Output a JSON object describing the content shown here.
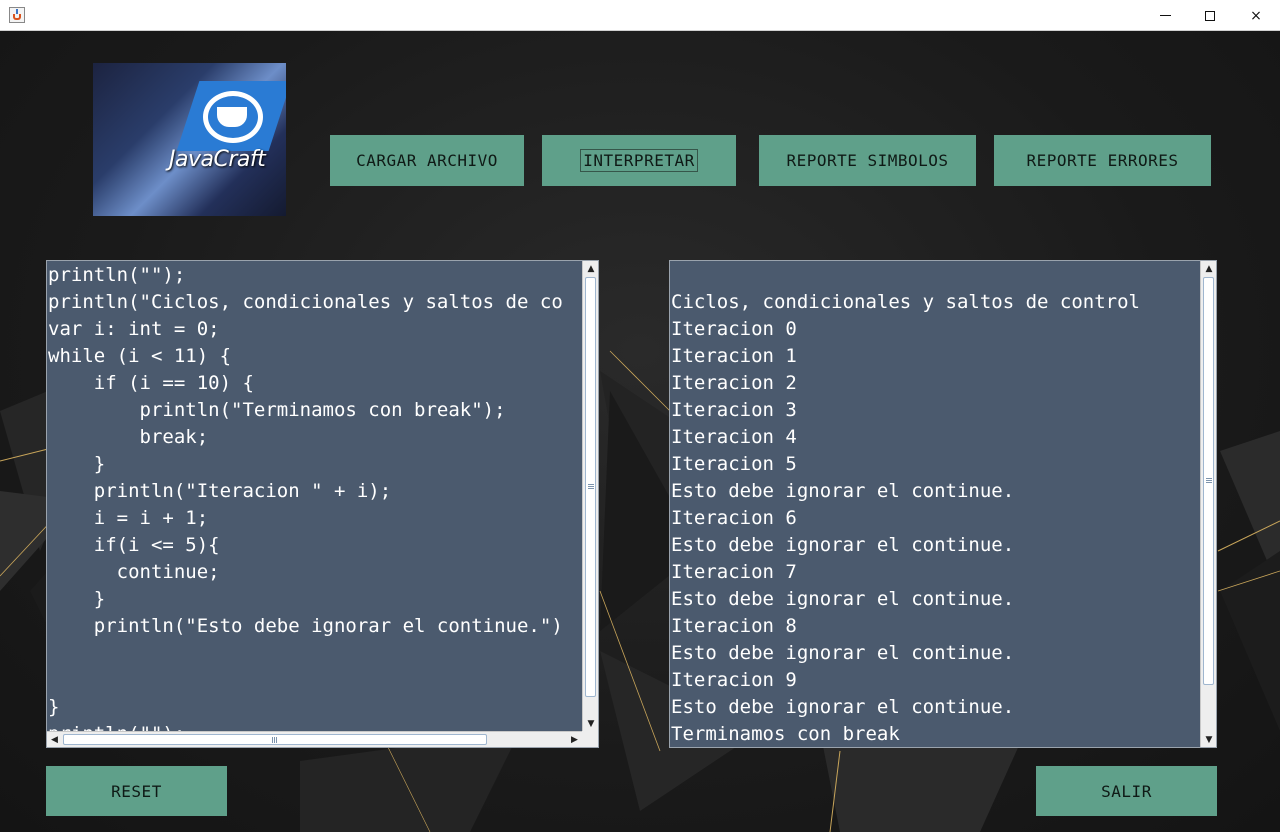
{
  "window": {
    "icon": "java-cup-icon",
    "controls": {
      "minimize": "minimize-icon",
      "maximize": "maximize-icon",
      "close": "×"
    }
  },
  "logo": {
    "text": "JavaCraft"
  },
  "toolbar": {
    "cargar": "CARGAR ARCHIVO",
    "interpretar": "INTERPRETAR",
    "reporte_simbolos": "REPORTE SIMBOLOS",
    "reporte_errores": "REPORTE ERRORES"
  },
  "editor": {
    "lines": [
      "println(\"\");",
      "println(\"Ciclos, condicionales y saltos de co",
      "var i: int = 0;",
      "while (i < 11) {",
      "    if (i == 10) {",
      "        println(\"Terminamos con break\");",
      "        break;",
      "    }",
      "    println(\"Iteracion \" + i);",
      "    i = i + 1;",
      "    if(i <= 5){",
      "      continue;",
      "    }",
      "    println(\"Esto debe ignorar el continue.\")",
      "",
      "",
      "}",
      "println(\"\");"
    ]
  },
  "console": {
    "lines": [
      "",
      "Ciclos, condicionales y saltos de control",
      "Iteracion 0",
      "Iteracion 1",
      "Iteracion 2",
      "Iteracion 3",
      "Iteracion 4",
      "Iteracion 5",
      "Esto debe ignorar el continue.",
      "Iteracion 6",
      "Esto debe ignorar el continue.",
      "Iteracion 7",
      "Esto debe ignorar el continue.",
      "Iteracion 8",
      "Esto debe ignorar el continue.",
      "Iteracion 9",
      "Esto debe ignorar el continue.",
      "Terminamos con break"
    ]
  },
  "footer": {
    "reset": "RESET",
    "salir": "SALIR"
  },
  "colors": {
    "button": "#5fa08a",
    "textarea": "#4b5a6e",
    "background": "#1e1e1e",
    "accent_lines": "#c8a55a"
  }
}
